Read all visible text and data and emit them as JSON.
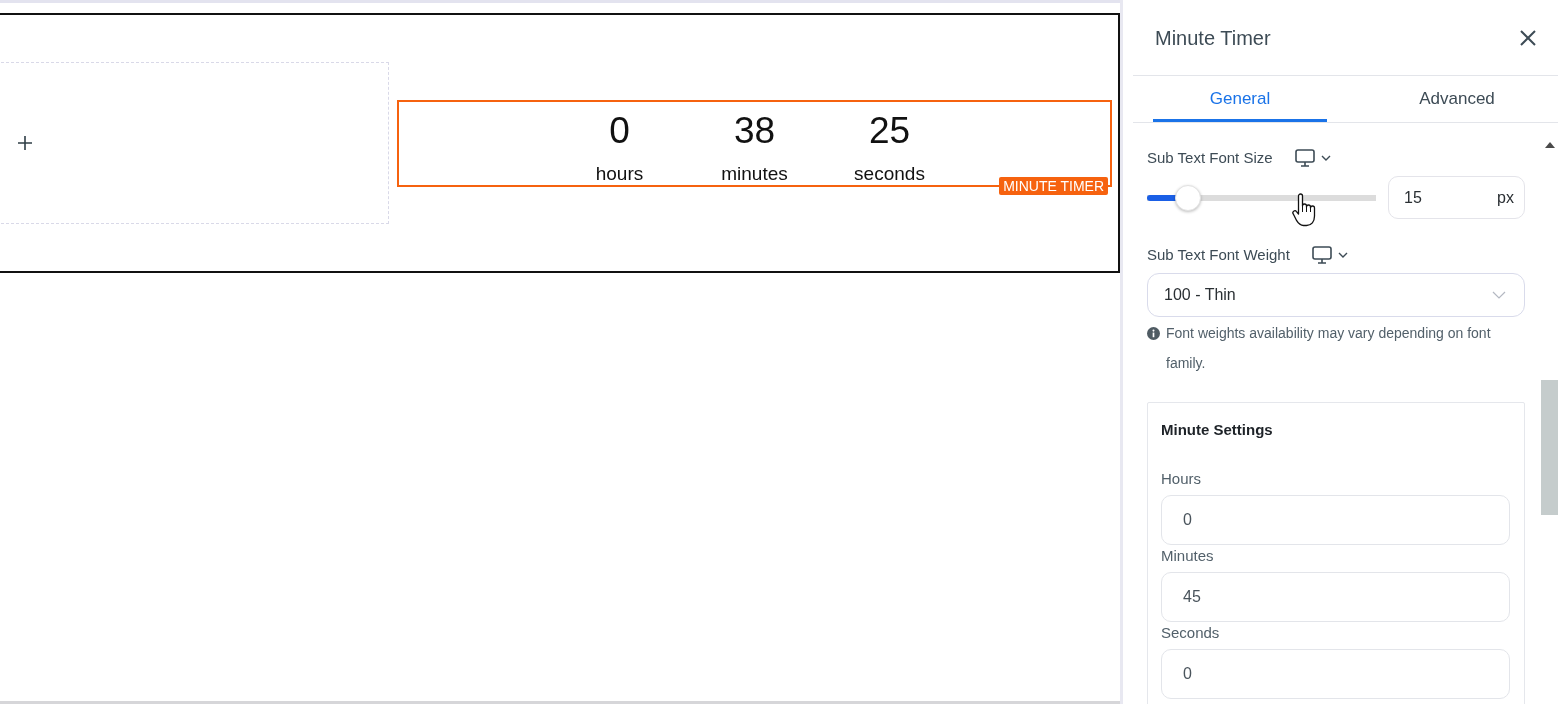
{
  "canvas": {
    "timer": {
      "units": [
        {
          "value": "0",
          "label": "hours"
        },
        {
          "value": "38",
          "label": "minutes"
        },
        {
          "value": "25",
          "label": "seconds"
        }
      ],
      "badge": "MINUTE TIMER"
    }
  },
  "panel": {
    "title": "Minute Timer",
    "tabs": [
      {
        "label": "General",
        "selected": true
      },
      {
        "label": "Advanced",
        "selected": false
      }
    ],
    "controls": [
      {
        "kind": "slider",
        "label": "Sub Text Font Size",
        "level": 0.18,
        "value": "15",
        "unit": "px"
      },
      {
        "kind": "select",
        "label": "Sub Text Font Weight",
        "value": "100 - Thin",
        "note": "Font weights availability may vary depending on font family."
      }
    ],
    "minute_settings": {
      "title": "Minute Settings",
      "fields": [
        {
          "label": "Hours",
          "value": "0"
        },
        {
          "label": "Minutes",
          "value": "45"
        },
        {
          "label": "Seconds",
          "value": "0"
        }
      ]
    }
  }
}
